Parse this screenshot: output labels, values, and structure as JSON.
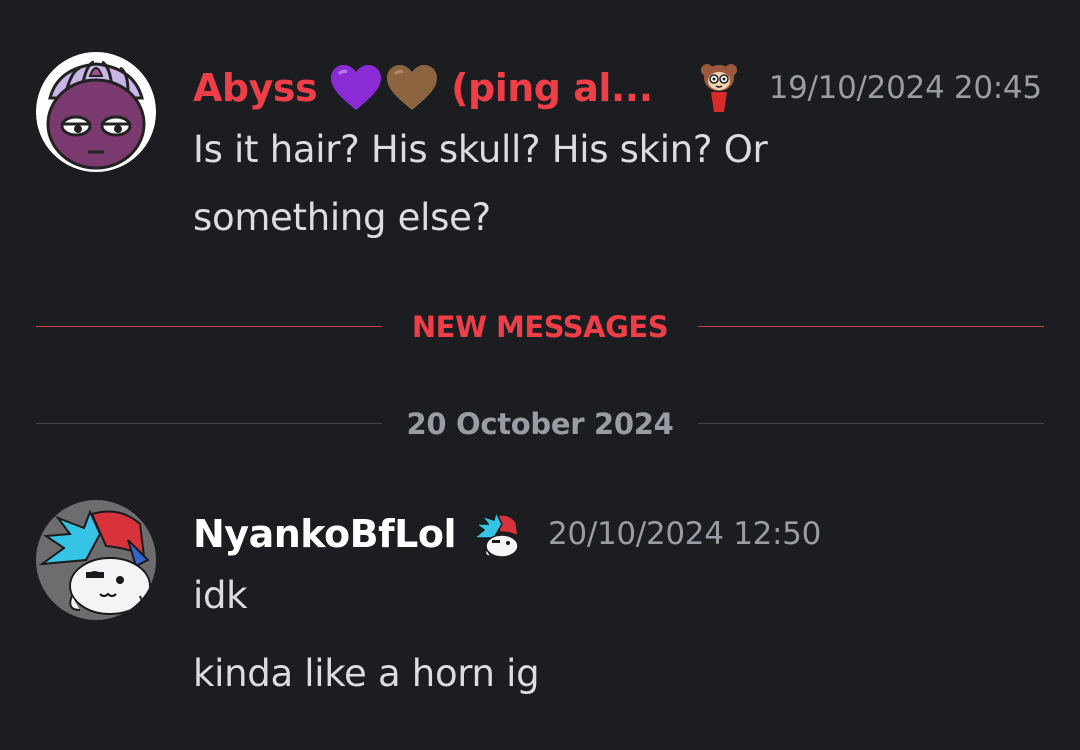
{
  "messages": [
    {
      "username": "Abyss",
      "name_suffix": "(ping al...",
      "name_color": "#ee3e47",
      "decorations": [
        "purple-heart-icon",
        "brown-heart-icon"
      ],
      "role_icon": "character-emoji-icon",
      "timestamp": "19/10/2024 20:45",
      "lines": [
        "Is it hair? His skull? His skin? Or",
        "something else?"
      ]
    },
    {
      "username": "NyankoBfLol",
      "name_color": "#ffffff",
      "role_icon": "boyfriend-character-icon",
      "timestamp": "20/10/2024 12:50",
      "lines": [
        "idk",
        "kinda like a horn ig"
      ]
    }
  ],
  "dividers": {
    "new_messages": "NEW MESSAGES",
    "date": "20 October 2024"
  },
  "colors": {
    "background": "#1c1d21",
    "accent_red": "#ee3e47",
    "muted": "#9a9ca3",
    "text": "#dcdde1"
  }
}
